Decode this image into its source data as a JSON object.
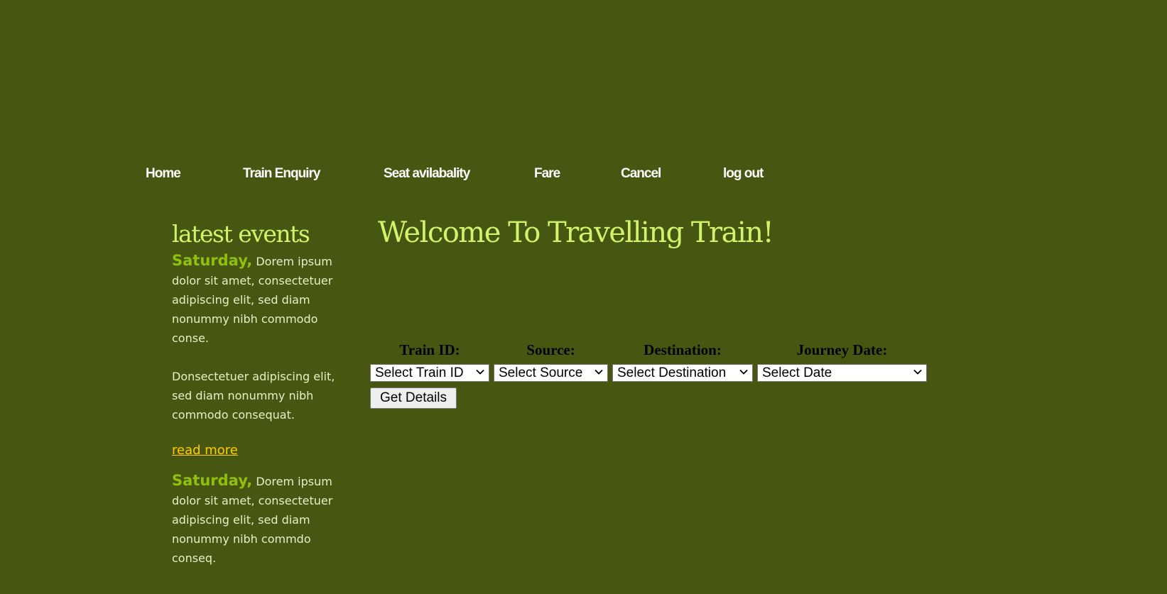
{
  "nav": {
    "items": [
      {
        "label": "Home"
      },
      {
        "label": "Train Enquiry"
      },
      {
        "label": "Seat avilabality"
      },
      {
        "label": "Fare"
      },
      {
        "label": "Cancel"
      },
      {
        "label": "log out"
      }
    ]
  },
  "sidebar": {
    "title": "latest events",
    "events": [
      {
        "day": "Saturday,",
        "text": " Dorem ipsum dolor sit amet, consectetuer adipiscing elit, sed diam nonummy nibh commodo conse."
      },
      {
        "text": "Donsectetuer adipiscing elit, sed diam nonummy nibh commodo consequat."
      },
      {
        "link": "read more"
      },
      {
        "day": "Saturday,",
        "text": " Dorem ipsum dolor sit amet, consectetuer adipiscing elit, sed diam nonummy nibh commdo conseq."
      }
    ]
  },
  "main": {
    "title": "Welcome To Travelling Train!",
    "form": {
      "labels": {
        "train_id": "Train ID:",
        "source": "Source:",
        "destination": "Destination:",
        "journey_date": "Journey Date:"
      },
      "selects": {
        "train_id": "Select Train ID",
        "source": "Select Source",
        "destination": "Select Destination",
        "journey_date": "Select Date"
      },
      "submit_label": "Get Details"
    }
  },
  "colors": {
    "background": "#475711",
    "heading": "#d6f26a",
    "day_label": "#8fc00c",
    "link": "#ffcc00",
    "nav_text": "#ffffff"
  }
}
